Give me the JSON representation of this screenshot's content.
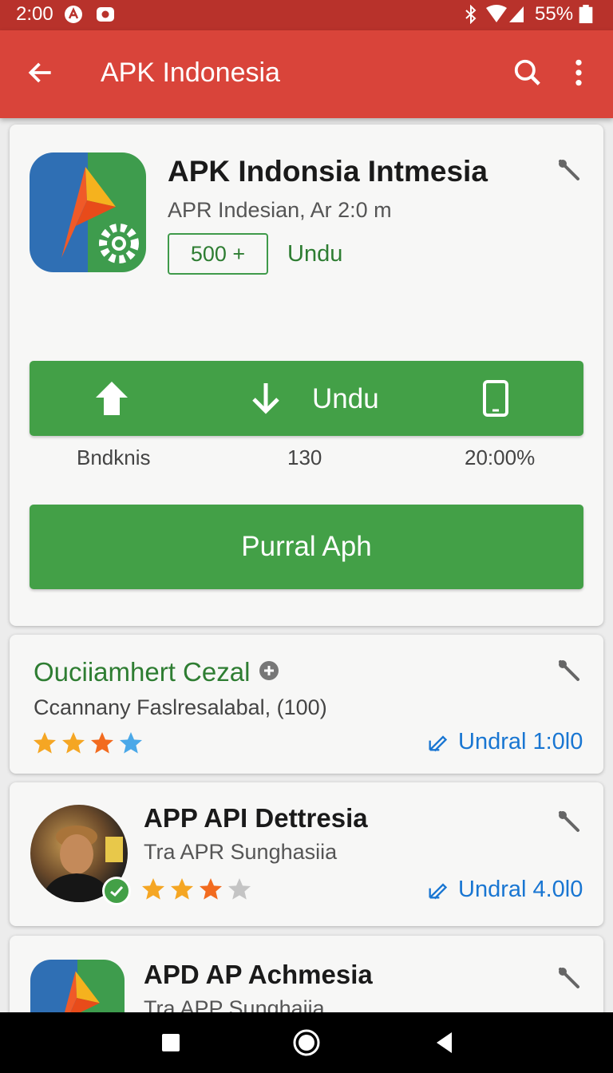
{
  "status_bar": {
    "time": "2:00",
    "battery": "55%"
  },
  "app_bar": {
    "title": "APK Indonesia",
    "back_icon": "arrow-left-icon",
    "search_icon": "search-icon",
    "more_icon": "more-vertical-icon"
  },
  "main_card": {
    "name": "APK Indonsia Intmesia",
    "subtitle": "APR Indesian, Ar 2:0 m",
    "download_count": "500 +",
    "download_label": "Undu",
    "action_bar": {
      "label": "Undu"
    },
    "stats": [
      "Bndknis",
      "130",
      "20:00%"
    ],
    "primary_button": "Purral Aph"
  },
  "review_card": {
    "title": "Ouciiamhert Cezal",
    "subtitle": "Ccannany Faslresalabal, (100)",
    "rating": 4,
    "link": "Undral 1:0l0"
  },
  "list_items": [
    {
      "name": "APP API Dettresia",
      "subtitle": "Tra APR Sunghasiia",
      "rating": 3,
      "link": "Undral 4.0l0"
    },
    {
      "name": "APD AP Achmesia",
      "subtitle": "Tra APP Sunghaiia"
    }
  ],
  "colors": {
    "app_bar": "#d9443a",
    "status_bar": "#b8322b",
    "green": "#43a047",
    "link_blue": "#1976d2",
    "star_gold": "#f5a623",
    "star_orange": "#f26b1f",
    "star_blue": "#4aa8e8"
  }
}
